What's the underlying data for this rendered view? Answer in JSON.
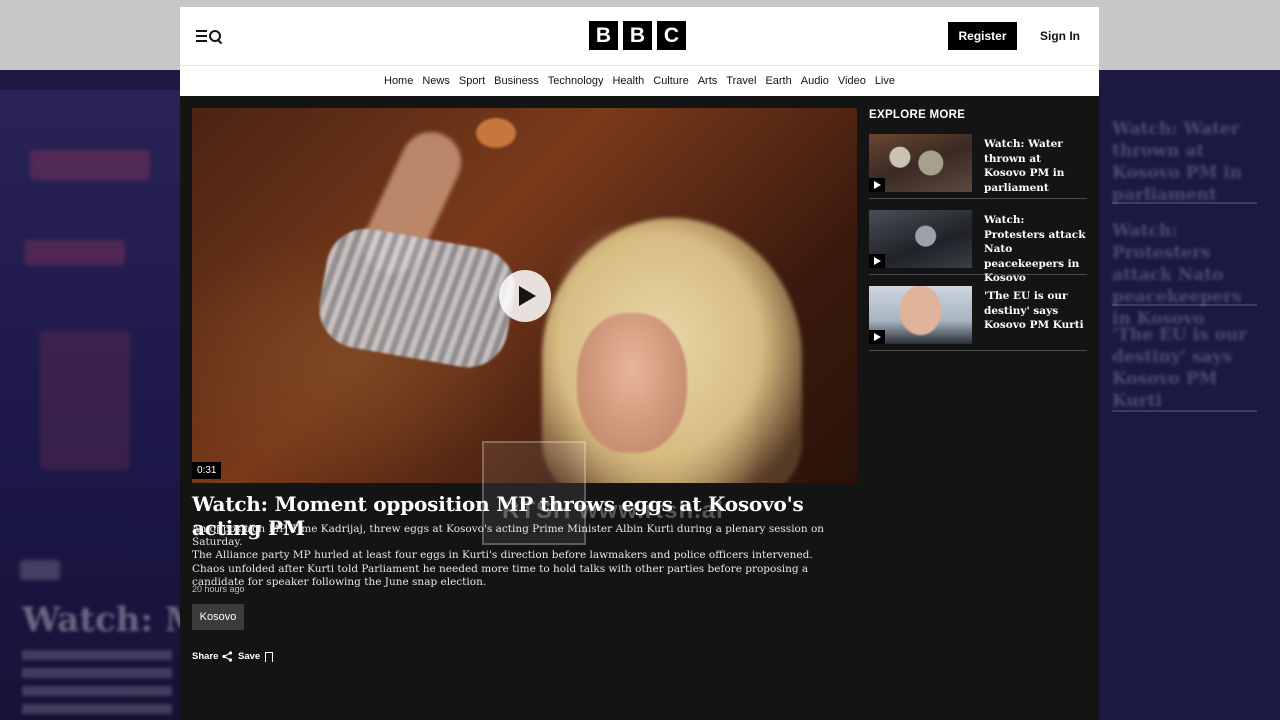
{
  "header": {
    "logo_letters": [
      "B",
      "B",
      "C"
    ],
    "register_label": "Register",
    "signin_label": "Sign In"
  },
  "nav": {
    "items": [
      "Home",
      "News",
      "Sport",
      "Business",
      "Technology",
      "Health",
      "Culture",
      "Arts",
      "Travel",
      "Earth",
      "Audio",
      "Video",
      "Live"
    ]
  },
  "video": {
    "duration": "0:31"
  },
  "article": {
    "title": "Watch: Moment opposition MP throws eggs at Kosovo's acting PM",
    "summary": [
      "An opposition MP, Time Kadrijaj, threw eggs at Kosovo's acting Prime Minister Albin Kurti during a plenary session on Saturday.",
      "The Alliance party MP hurled at least four eggs in Kurti's direction before lawmakers and police officers intervened.",
      "Chaos unfolded after Kurti told Parliament he needed more time to hold talks with other parties before proposing a candidate for speaker following the June snap election."
    ],
    "time_ago": "20 hours ago",
    "tag": "Kosovo",
    "share_label": "Share",
    "save_label": "Save"
  },
  "watermark": {
    "text": "RTSH www.rtsh.al"
  },
  "explore": {
    "heading": "EXPLORE MORE",
    "items": [
      {
        "headline": "Watch: Water thrown at Kosovo PM in parliament"
      },
      {
        "headline": "Watch: Protesters attack Nato peacekeepers in Kosovo"
      },
      {
        "headline": "'The EU is our destiny' says Kosovo PM Kurti"
      }
    ]
  },
  "background": {
    "left_text": "Watch: Mon",
    "right_items": [
      "Watch: Water thrown at Kosovo PM in parliament",
      "Watch: Protesters attack Nato peacekeepers in Kosovo",
      "'The EU is our destiny' says Kosovo PM Kurti"
    ]
  }
}
